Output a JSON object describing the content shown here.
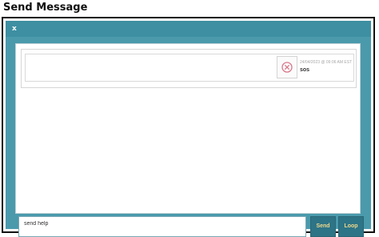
{
  "page": {
    "title": "Send Message"
  },
  "dialog": {
    "close_label": "x"
  },
  "messages": [
    {
      "meta": "24/04/2023 @ 09:06 AM EST",
      "text": "sos"
    }
  ],
  "composer": {
    "input_value": "send help",
    "placeholder": ""
  },
  "buttons": {
    "send_label": "Send",
    "loop_label": "Loop"
  },
  "colors": {
    "accent": "#3d8fa1",
    "button": "#2d7486",
    "button_text": "#f0d98c",
    "delete_icon": "#d9788a"
  },
  "icons": {
    "close": "close-icon",
    "delete": "delete-icon"
  }
}
